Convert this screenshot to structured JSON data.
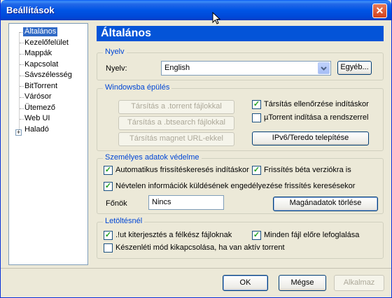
{
  "window": {
    "title": "Beállítások",
    "close_glyph": "✕"
  },
  "tree": {
    "items": [
      {
        "label": "Általános",
        "selected": true
      },
      {
        "label": "Kezelőfelület"
      },
      {
        "label": "Mappák"
      },
      {
        "label": "Kapcsolat"
      },
      {
        "label": "Sávszélesség"
      },
      {
        "label": "BitTorrent"
      },
      {
        "label": "Várósor"
      },
      {
        "label": "Ütemező"
      },
      {
        "label": "Web UI"
      },
      {
        "label": "Haladó",
        "expandable": true
      }
    ],
    "expander_glyph": "+"
  },
  "header": {
    "title": "Általános"
  },
  "language": {
    "group_label": "Nyelv",
    "field_label": "Nyelv:",
    "selected_value": "English",
    "other_button": "Egyéb..."
  },
  "windows_integration": {
    "group_label": "Windowsba épülés",
    "assoc_torrent_button": "Társítás a .torrent fájlokkal",
    "assoc_btsearch_button": "Társítás a .btsearch fájlokkal",
    "assoc_magnet_button": "Társítás magnet URL-ekkel",
    "check_association_label": "Társítás ellenőrzése indításkor",
    "check_association_checked": true,
    "start_with_system_label": "µTorrent indítása a rendszerrel",
    "start_with_system_checked": false,
    "ipv6_button": "IPv6/Teredo telepítése"
  },
  "privacy": {
    "group_label": "Személyes adatok védelme",
    "auto_update_label": "Automatikus frissítéskeresés indításkor",
    "auto_update_checked": true,
    "beta_update_label": "Frissítés béta verziókra is",
    "beta_update_checked": true,
    "anonymous_info_label": "Névtelen információk küldésének engedélyezése frissítés keresésekor",
    "anonymous_info_checked": true,
    "boss_label": "Főnök",
    "boss_value": "Nincs",
    "clear_private_button": "Magánadatok törlése"
  },
  "downloads": {
    "group_label": "Letöltésnél",
    "ut_extension_label": ".!ut kiterjesztés a félkész fájloknak",
    "ut_extension_checked": true,
    "preallocate_label": "Minden fájl előre lefoglalása",
    "preallocate_checked": true,
    "standby_label": "Készenléti mód kikapcsolása, ha van aktív torrent",
    "standby_checked": false
  },
  "footer": {
    "ok_button": "OK",
    "cancel_button": "Mégse",
    "apply_button": "Alkalmaz"
  },
  "check_glyph": "✓",
  "colors": {
    "titlebar": "#0055e5",
    "selection": "#316ac5",
    "header_band": "#0454d8",
    "group_label": "#0046d5",
    "window_bg": "#ece9d8"
  }
}
